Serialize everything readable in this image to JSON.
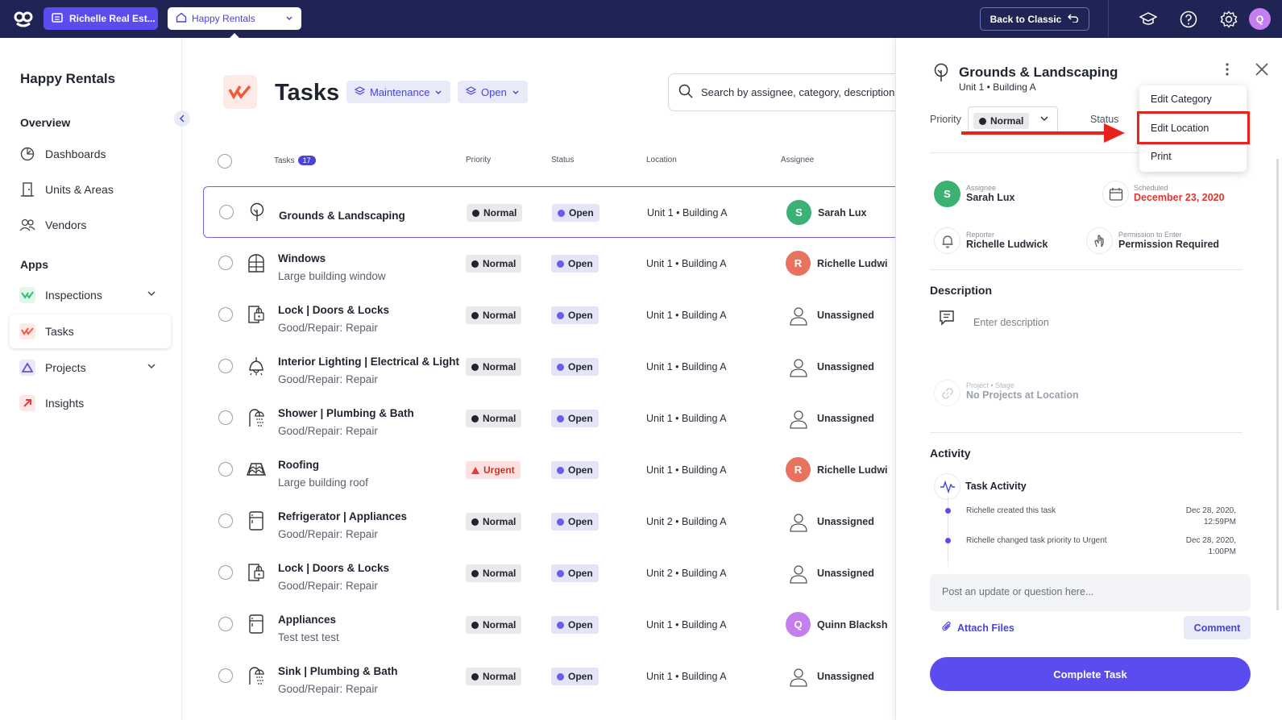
{
  "topbar": {
    "org_label": "Richelle Real Est...",
    "property_label": "Happy Rentals",
    "back_label": "Back to Classic",
    "avatar_initial": "Q"
  },
  "sidebar": {
    "title": "Happy Rentals",
    "overview_heading": "Overview",
    "overview_items": [
      {
        "label": "Dashboards",
        "icon": "dashboard-icon"
      },
      {
        "label": "Units & Areas",
        "icon": "door-icon"
      },
      {
        "label": "Vendors",
        "icon": "vendors-icon"
      }
    ],
    "apps_heading": "Apps",
    "apps_items": [
      {
        "label": "Inspections",
        "icon": "inspections-icon"
      },
      {
        "label": "Tasks",
        "icon": "tasks-icon"
      },
      {
        "label": "Projects",
        "icon": "projects-icon"
      },
      {
        "label": "Insights",
        "icon": "insights-icon"
      }
    ]
  },
  "main": {
    "title": "Tasks",
    "filters": [
      "Maintenance",
      "Open"
    ],
    "search_placeholder": "Search by assignee, category, description,",
    "columns": {
      "tasks": "Tasks",
      "count": "17",
      "priority": "Priority",
      "status": "Status",
      "location": "Location",
      "assignee": "Assignee"
    },
    "rows": [
      {
        "name": "Grounds & Landscaping",
        "sub": "",
        "priority": "Normal",
        "status": "Open",
        "location": "Unit 1 • Building A",
        "assignee": "Sarah Lux",
        "initial": "S",
        "avatar_color": "#3bb273",
        "icon": "tree-icon"
      },
      {
        "name": "Windows",
        "sub": "Large building window",
        "priority": "Normal",
        "status": "Open",
        "location": "Unit 1 • Building A",
        "assignee": "Richelle Ludwi",
        "initial": "R",
        "avatar_color": "#e8715f",
        "icon": "window-icon"
      },
      {
        "name": "Lock | Doors & Locks",
        "sub": "Good/Repair: Repair",
        "priority": "Normal",
        "status": "Open",
        "location": "Unit 1 • Building A",
        "assignee": "Unassigned",
        "initial": "",
        "avatar_color": "",
        "icon": "lock-icon"
      },
      {
        "name": "Interior Lighting | Electrical & Light",
        "sub": "Good/Repair: Repair",
        "priority": "Normal",
        "status": "Open",
        "location": "Unit 1 • Building A",
        "assignee": "Unassigned",
        "initial": "",
        "avatar_color": "",
        "icon": "lamp-icon"
      },
      {
        "name": "Shower | Plumbing & Bath",
        "sub": "Good/Repair: Repair",
        "priority": "Normal",
        "status": "Open",
        "location": "Unit 1 • Building A",
        "assignee": "Unassigned",
        "initial": "",
        "avatar_color": "",
        "icon": "shower-icon"
      },
      {
        "name": "Roofing",
        "sub": "Large building roof",
        "priority": "Urgent",
        "status": "Open",
        "location": "Unit 1 • Building A",
        "assignee": "Richelle Ludwi",
        "initial": "R",
        "avatar_color": "#e8715f",
        "icon": "roof-icon"
      },
      {
        "name": "Refrigerator | Appliances",
        "sub": "Good/Repair: Repair",
        "priority": "Normal",
        "status": "Open",
        "location": "Unit 2 • Building A",
        "assignee": "Unassigned",
        "initial": "",
        "avatar_color": "",
        "icon": "fridge-icon"
      },
      {
        "name": "Lock | Doors & Locks",
        "sub": "Good/Repair: Repair",
        "priority": "Normal",
        "status": "Open",
        "location": "Unit 2 • Building A",
        "assignee": "Unassigned",
        "initial": "",
        "avatar_color": "",
        "icon": "lock-icon"
      },
      {
        "name": "Appliances",
        "sub": "Test test test",
        "priority": "Normal",
        "status": "Open",
        "location": "Unit 1 • Building A",
        "assignee": "Quinn Blacksh",
        "initial": "Q",
        "avatar_color": "#c47ef0",
        "icon": "fridge-icon"
      },
      {
        "name": "Sink | Plumbing & Bath",
        "sub": "Good/Repair: Repair",
        "priority": "Normal",
        "status": "Open",
        "location": "Unit 1 • Building A",
        "assignee": "Unassigned",
        "initial": "",
        "avatar_color": "",
        "icon": "shower-icon"
      }
    ]
  },
  "panel": {
    "title": "Grounds & Landscaping",
    "subtitle": "Unit 1 • Building A",
    "priority_label": "Priority",
    "priority_value": "Normal",
    "status_label": "Status",
    "assignee_label": "Assignee",
    "assignee_value": "Sarah Lux",
    "assignee_initial": "S",
    "scheduled_label": "Scheduled",
    "scheduled_value": "December 23, 2020",
    "reporter_label": "Reporter",
    "reporter_value": "Richelle Ludwick",
    "permission_label": "Permission to Enter",
    "permission_value": "Permission Required",
    "description_heading": "Description",
    "description_placeholder": "Enter description",
    "project_label": "Project • Stage",
    "project_value": "No Projects at Location",
    "activity_heading": "Activity",
    "task_activity": "Task Activity",
    "activities": [
      {
        "text": "Richelle created this task",
        "date": "Dec 28, 2020,",
        "time": "12:59PM"
      },
      {
        "text": "Richelle changed task priority to Urgent",
        "date": "Dec 28, 2020,",
        "time": "1:00PM"
      }
    ],
    "post_placeholder": "Post an update or question here...",
    "attach_label": "Attach Files",
    "comment_label": "Comment",
    "complete_label": "Complete Task"
  },
  "menu": {
    "items": [
      "Edit Category",
      "Edit Location",
      "Print"
    ]
  },
  "colors": {
    "accent": "#5b4cf0",
    "topbar": "#1f2454",
    "annotation_red": "#e8231b"
  }
}
